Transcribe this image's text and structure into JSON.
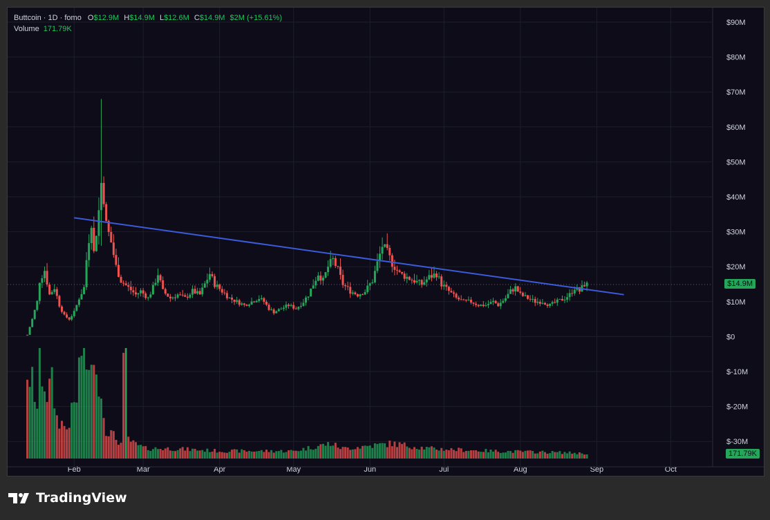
{
  "legend": {
    "symbol": "Buttcoin · 1D · fomo",
    "open_label": "O",
    "open": "$12.9M",
    "high_label": "H",
    "high": "$14.9M",
    "low_label": "L",
    "low": "$12.6M",
    "close_label": "C",
    "close": "$14.9M",
    "change": "$2M (+15.61%)",
    "volume_label": "Volume",
    "volume": "171.79K"
  },
  "price_tag": "$14.9M",
  "volume_tag": "171.79K",
  "footer": {
    "brand": "TradingView"
  },
  "colors": {
    "up": "#26a65b",
    "down": "#ef5350",
    "trendline": "#3b5bdb",
    "background": "#0d0c18"
  },
  "chart_data": {
    "type": "candlestick",
    "y_ticks": [
      "$90M",
      "$80M",
      "$70M",
      "$60M",
      "$50M",
      "$40M",
      "$30M",
      "$20M",
      "$10M",
      "$0",
      "$-10M",
      "$-20M",
      "$-30M"
    ],
    "y_tick_values": [
      90,
      80,
      70,
      60,
      50,
      40,
      30,
      20,
      10,
      0,
      -10,
      -20,
      -30
    ],
    "x_ticks": [
      "Feb",
      "Mar",
      "Apr",
      "May",
      "Jun",
      "Jul",
      "Aug",
      "Sep",
      "Oct"
    ],
    "x_tick_days": [
      31,
      59,
      90,
      120,
      151,
      181,
      212,
      243,
      273
    ],
    "ylim": [
      -35,
      95
    ],
    "xlim": [
      4,
      290
    ],
    "last_price": 14.9,
    "trendline": {
      "start": [
        31,
        34
      ],
      "end": [
        254,
        12
      ]
    },
    "price_path": [
      [
        12,
        0.5
      ],
      [
        14,
        5
      ],
      [
        16,
        10
      ],
      [
        17,
        16
      ],
      [
        19,
        19
      ],
      [
        21,
        12
      ],
      [
        23,
        14
      ],
      [
        25,
        9
      ],
      [
        27,
        6
      ],
      [
        29,
        5
      ],
      [
        31,
        7
      ],
      [
        33,
        11
      ],
      [
        35,
        14
      ],
      [
        36,
        22
      ],
      [
        37,
        28
      ],
      [
        38,
        33
      ],
      [
        39,
        24
      ],
      [
        40,
        30
      ],
      [
        41,
        36
      ],
      [
        42,
        44
      ],
      [
        43,
        40
      ],
      [
        44,
        32
      ],
      [
        46,
        27
      ],
      [
        48,
        20
      ],
      [
        50,
        16
      ],
      [
        53,
        14
      ],
      [
        56,
        12
      ],
      [
        58,
        13
      ],
      [
        61,
        11
      ],
      [
        63,
        14
      ],
      [
        65,
        18
      ],
      [
        67,
        13
      ],
      [
        70,
        11
      ],
      [
        73,
        12
      ],
      [
        76,
        11
      ],
      [
        79,
        13
      ],
      [
        82,
        12
      ],
      [
        84,
        15
      ],
      [
        86,
        18
      ],
      [
        88,
        15
      ],
      [
        91,
        13
      ],
      [
        94,
        11
      ],
      [
        97,
        10
      ],
      [
        100,
        9
      ],
      [
        103,
        10
      ],
      [
        106,
        11
      ],
      [
        108,
        10
      ],
      [
        110,
        8
      ],
      [
        112,
        7
      ],
      [
        115,
        8
      ],
      [
        118,
        9
      ],
      [
        121,
        8
      ],
      [
        124,
        10
      ],
      [
        126,
        12
      ],
      [
        128,
        15
      ],
      [
        130,
        18
      ],
      [
        132,
        16
      ],
      [
        134,
        20
      ],
      [
        136,
        22
      ],
      [
        138,
        19
      ],
      [
        140,
        15
      ],
      [
        143,
        13
      ],
      [
        146,
        12
      ],
      [
        149,
        13
      ],
      [
        152,
        16
      ],
      [
        154,
        21
      ],
      [
        156,
        26
      ],
      [
        158,
        24
      ],
      [
        160,
        21
      ],
      [
        163,
        18
      ],
      [
        166,
        17
      ],
      [
        169,
        16
      ],
      [
        172,
        15
      ],
      [
        175,
        17
      ],
      [
        178,
        18
      ],
      [
        180,
        15
      ],
      [
        183,
        13
      ],
      [
        186,
        11
      ],
      [
        189,
        10
      ],
      [
        192,
        10
      ],
      [
        195,
        9
      ],
      [
        198,
        9
      ],
      [
        201,
        10
      ],
      [
        203,
        9
      ],
      [
        206,
        11
      ],
      [
        208,
        13
      ],
      [
        210,
        14
      ],
      [
        212,
        12
      ],
      [
        215,
        11
      ],
      [
        218,
        10
      ],
      [
        221,
        10
      ],
      [
        224,
        9
      ],
      [
        227,
        10
      ],
      [
        230,
        11
      ],
      [
        232,
        12
      ],
      [
        234,
        14
      ],
      [
        236,
        13
      ],
      [
        238,
        15
      ],
      [
        239,
        14.9
      ]
    ],
    "volume_path": [
      [
        12,
        18
      ],
      [
        13,
        12
      ],
      [
        14,
        16
      ],
      [
        16,
        10
      ],
      [
        17,
        22
      ],
      [
        18,
        17
      ],
      [
        20,
        13
      ],
      [
        22,
        15
      ],
      [
        24,
        8
      ],
      [
        26,
        7
      ],
      [
        28,
        6
      ],
      [
        30,
        9
      ],
      [
        32,
        12
      ],
      [
        33,
        18
      ],
      [
        34,
        22
      ],
      [
        35,
        30
      ],
      [
        36,
        18
      ],
      [
        37,
        20
      ],
      [
        38,
        17
      ],
      [
        39,
        16
      ],
      [
        40,
        22
      ],
      [
        41,
        15
      ],
      [
        42,
        12
      ],
      [
        44,
        6
      ],
      [
        46,
        5
      ],
      [
        48,
        4
      ],
      [
        50,
        3
      ],
      [
        52,
        32
      ],
      [
        53,
        4
      ],
      [
        55,
        3
      ],
      [
        60,
        2
      ],
      [
        70,
        2
      ],
      [
        90,
        1.5
      ],
      [
        120,
        1.5
      ],
      [
        135,
        3
      ],
      [
        140,
        2
      ],
      [
        160,
        3
      ],
      [
        175,
        2
      ],
      [
        200,
        1.5
      ],
      [
        230,
        1.2
      ],
      [
        239,
        1
      ]
    ]
  }
}
